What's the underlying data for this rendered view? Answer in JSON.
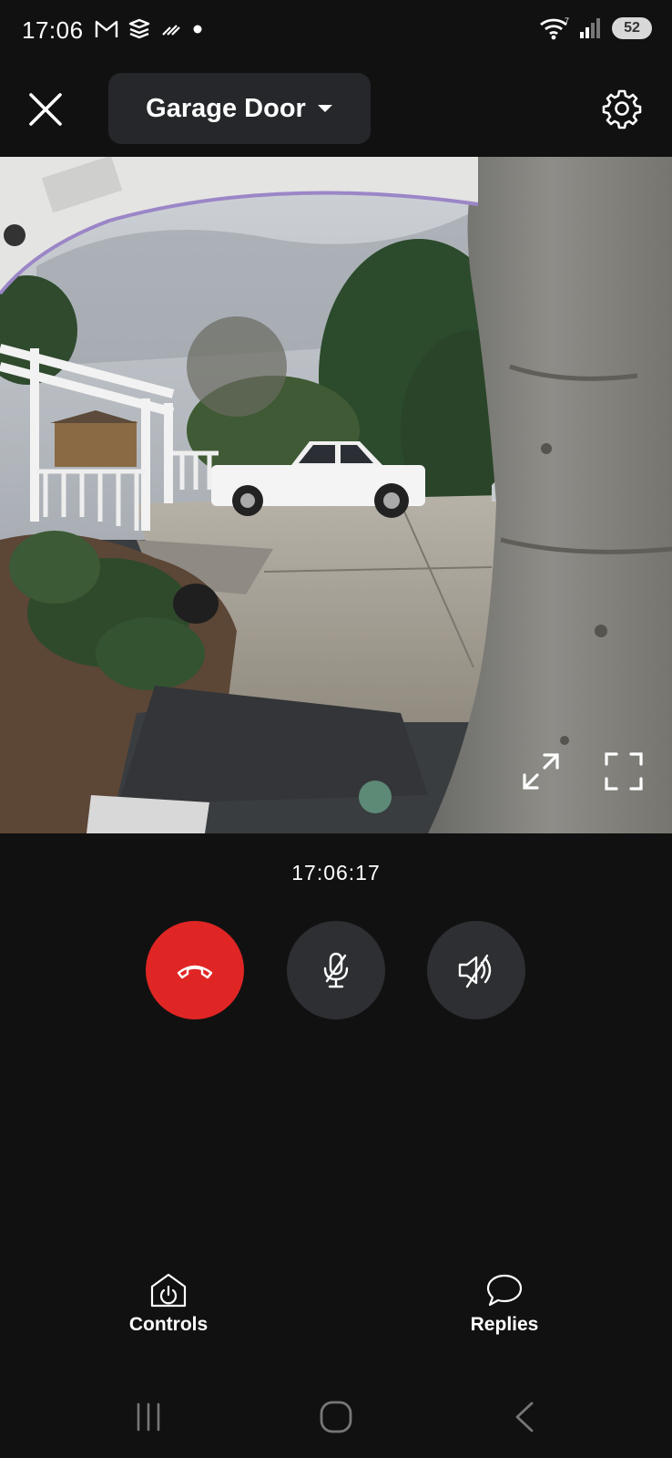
{
  "status_bar": {
    "time": "17:06",
    "battery": "52",
    "left_icons": [
      "gmail-icon",
      "app-icon",
      "signal-app-icon",
      "dot-icon"
    ],
    "right_icons": [
      "wifi-icon",
      "cell-signal-icon",
      "battery-icon"
    ]
  },
  "header": {
    "device_name": "Garage Door",
    "close_icon": "close-icon",
    "dropdown_icon": "caret-down-icon",
    "settings_icon": "gear-icon"
  },
  "video": {
    "expand_icon": "expand-icon",
    "fullscreen_icon": "fullscreen-icon"
  },
  "call": {
    "timestamp": "17:06:17",
    "buttons": [
      {
        "icon": "hang-up-icon",
        "color": "#e02625"
      },
      {
        "icon": "mic-off-icon",
        "color": "#2d2f32"
      },
      {
        "icon": "speaker-off-icon",
        "color": "#2d2f32"
      }
    ]
  },
  "actions": {
    "controls_label": "Controls",
    "replies_label": "Replies"
  },
  "colors": {
    "background": "#111111",
    "accent_red": "#e02625",
    "button_gray": "#2d2f32",
    "pill_gray": "#25272a"
  }
}
